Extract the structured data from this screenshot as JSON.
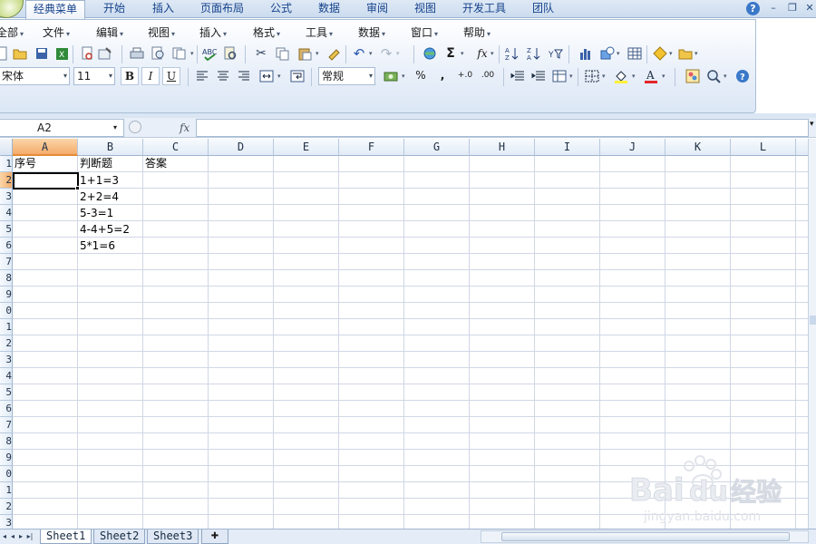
{
  "tabs": [
    {
      "label": "经典菜单",
      "active": true
    },
    {
      "label": "开始"
    },
    {
      "label": "插入"
    },
    {
      "label": "页面布局"
    },
    {
      "label": "公式"
    },
    {
      "label": "数据"
    },
    {
      "label": "审阅"
    },
    {
      "label": "视图"
    },
    {
      "label": "开发工具"
    },
    {
      "label": "团队"
    }
  ],
  "menus": [
    "全部",
    "文件",
    "编辑",
    "视图",
    "插入",
    "格式",
    "工具",
    "数据",
    "窗口",
    "帮助"
  ],
  "format": {
    "font_name": "宋体",
    "font_size": "11",
    "number_format": "常规",
    "bold": "B",
    "italic": "I",
    "underline": "U",
    "percent": "%",
    "comma": ",",
    "inc_decimal": "+.0",
    "dec_decimal": ".00",
    "autosum": "Σ",
    "function": "fx"
  },
  "formula_bar": {
    "name_box": "A2",
    "fx_label": "fx",
    "formula": ""
  },
  "columns": [
    "A",
    "B",
    "C",
    "D",
    "E",
    "F",
    "G",
    "H",
    "I",
    "J",
    "K",
    "L"
  ],
  "selected_column": "A",
  "rows": [
    "1",
    "2",
    "3",
    "4",
    "5",
    "6",
    "7",
    "8",
    "9",
    "0",
    "1",
    "2",
    "3",
    "4",
    "5",
    "6",
    "7",
    "8",
    "9",
    "0",
    "1",
    "2",
    "3"
  ],
  "selected_row": "2",
  "cells": {
    "A1": "序号",
    "B1": "判断题",
    "C1": "答案",
    "B2": "1+1=3",
    "B3": "2+2=4",
    "B4": "5-3=1",
    "B5": "4-4+5=2",
    "B6": "5*1=6"
  },
  "sheets": [
    {
      "label": "Sheet1",
      "active": true
    },
    {
      "label": "Sheet2"
    },
    {
      "label": "Sheet3"
    }
  ],
  "watermark": {
    "text": "Bai du 经验",
    "url_text": "jingyan.baidu.com"
  }
}
